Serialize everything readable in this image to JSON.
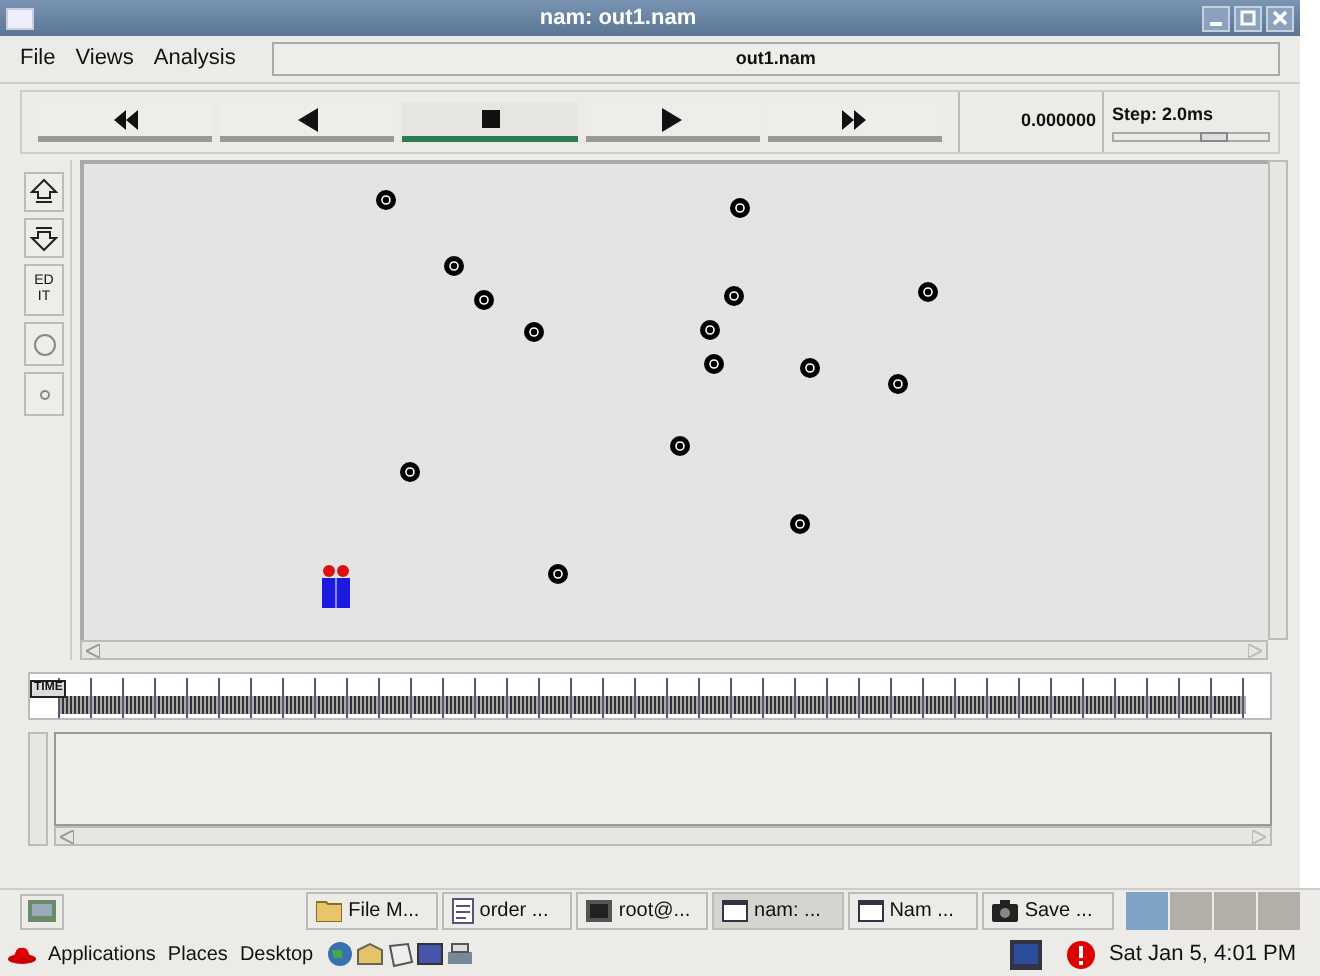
{
  "window": {
    "title": "nam: out1.nam"
  },
  "menu": [
    "File",
    "Views",
    "Analysis"
  ],
  "file_label": "out1.nam",
  "transport": [
    {
      "kind": "rewind",
      "selected": false
    },
    {
      "kind": "back",
      "selected": false
    },
    {
      "kind": "stop",
      "selected": true
    },
    {
      "kind": "play",
      "selected": false
    },
    {
      "kind": "forward",
      "selected": false
    }
  ],
  "time_value": "0.000000",
  "step": {
    "label": "Step: 2.0ms",
    "level": 0.65
  },
  "edit_tool": "ED IT",
  "time_slider": {
    "label": "TIME",
    "level": 0
  },
  "taskbar": [
    {
      "label": "File M...",
      "kind": "folder",
      "selected": false
    },
    {
      "label": "order ...",
      "kind": "document",
      "selected": false
    },
    {
      "label": "root@...",
      "kind": "terminal",
      "selected": false
    },
    {
      "label": "nam: ...",
      "kind": "window",
      "selected": true
    },
    {
      "label": "Nam ...",
      "kind": "window",
      "selected": false
    },
    {
      "label": "Save ...",
      "kind": "camera",
      "selected": false
    }
  ],
  "workspaces": [
    {
      "selected": true
    },
    {
      "selected": false
    },
    {
      "selected": false
    },
    {
      "selected": false
    }
  ],
  "panel_menus": [
    "Applications",
    "Places",
    "Desktop"
  ],
  "clock": "Sat Jan 5, 4:01 PM"
}
